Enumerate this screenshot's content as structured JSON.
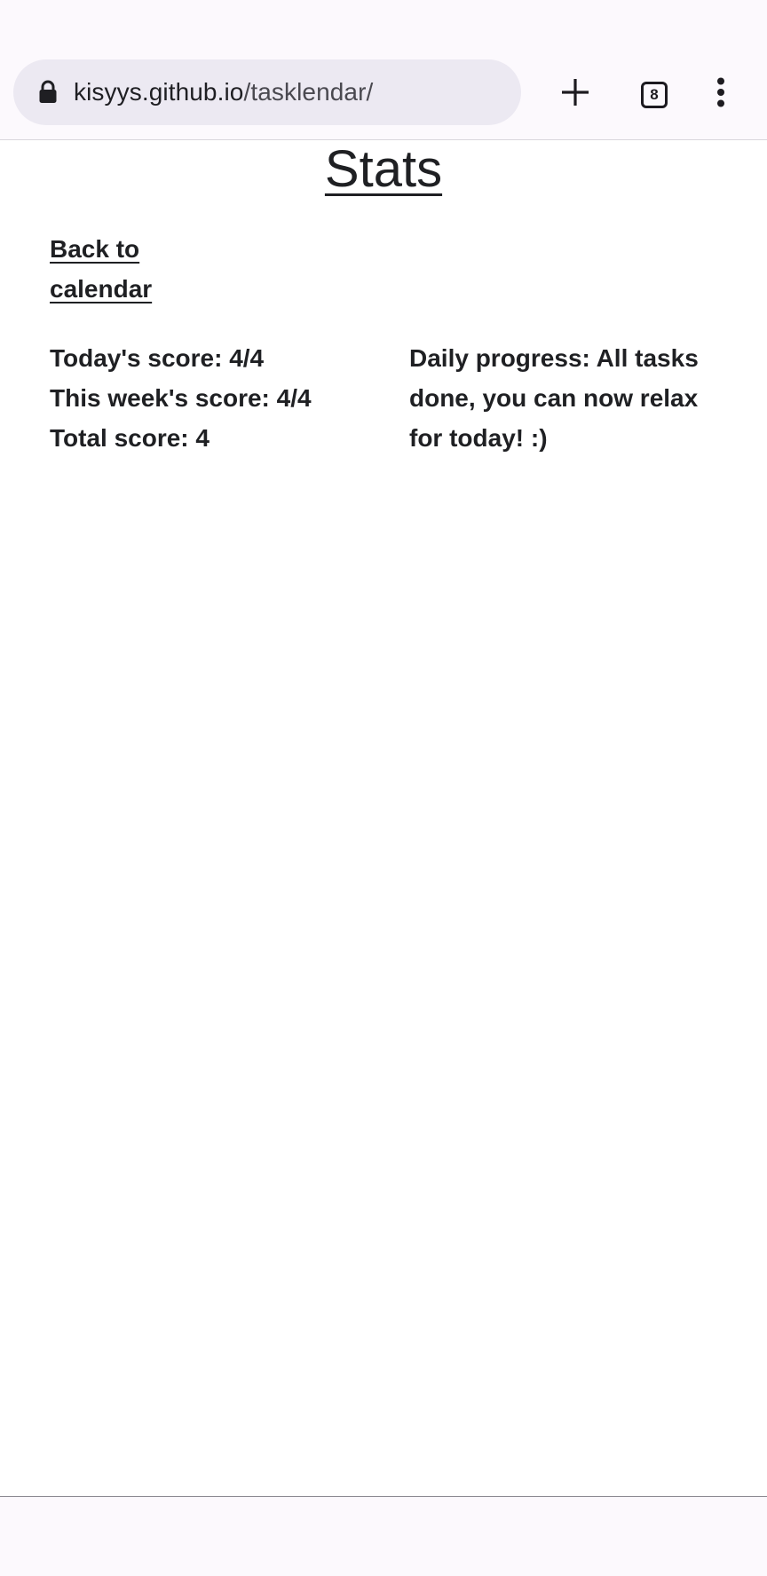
{
  "browser": {
    "url_host": "kisyys.github.io",
    "url_path": "/tasklendar/",
    "tab_count": "8",
    "icons": {
      "lock": "lock-icon",
      "new_tab": "plus-icon",
      "tabs": "tab-switcher-icon",
      "menu": "more-vert-icon"
    }
  },
  "page": {
    "title": "Stats",
    "back_link": "Back to calendar",
    "scores": {
      "today": "Today's score: 4/4",
      "week": "This week's score: 4/4",
      "total": "Total score: 4"
    },
    "daily_progress": "Daily progress: All tasks done, you can now relax for today! :)"
  },
  "colors": {
    "text": "#1f2023",
    "chrome_bg": "#fcf9fd",
    "omnibox_bg": "#ece9f2"
  }
}
